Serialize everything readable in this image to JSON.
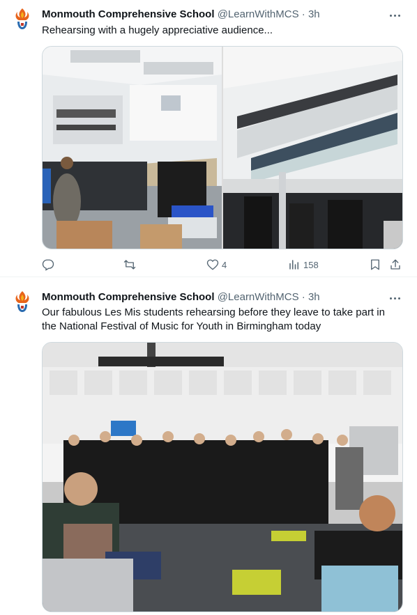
{
  "tweets": [
    {
      "name": "Monmouth Comprehensive School",
      "handle": "@LearnWithMCS",
      "sep": "·",
      "time": "3h",
      "text": "Rehearsing with a hugely appreciative audience...",
      "stats": {
        "likes": "4",
        "views": "158"
      },
      "photos": [
        "photo-atrium-wide",
        "photo-balcony-audience"
      ]
    },
    {
      "name": "Monmouth Comprehensive School",
      "handle": "@LearnWithMCS",
      "sep": "·",
      "time": "3h",
      "text": "Our fabulous Les Mis students rehearsing before they leave to take part in the National Festival of Music for Youth in Birmingham today",
      "photos": [
        "photo-students-rehearsal"
      ]
    }
  ],
  "icons": {
    "avatar": "school-logo-icon",
    "more": "more-icon",
    "reply": "reply-icon",
    "retweet": "retweet-icon",
    "like": "like-icon",
    "views": "views-icon",
    "bookmark": "bookmark-icon",
    "share": "share-icon"
  },
  "colors": {
    "text": "#0f1419",
    "secondary": "#536471",
    "border": "#cfd9de"
  }
}
